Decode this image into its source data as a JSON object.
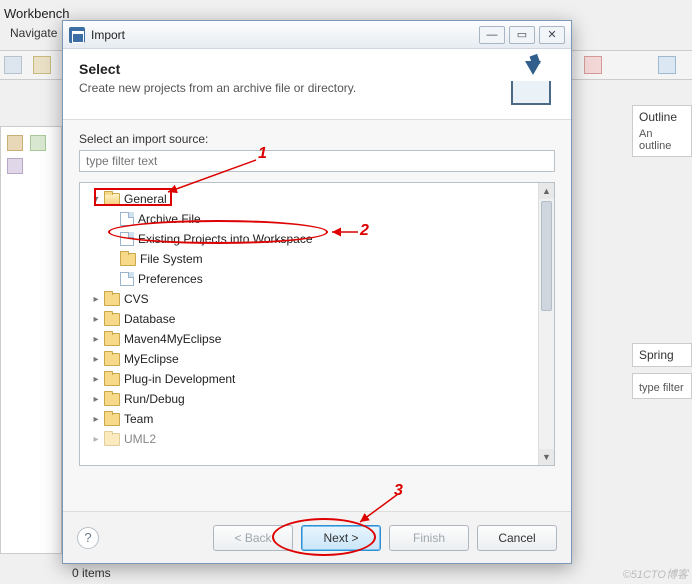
{
  "workbench": {
    "title": "Workbench",
    "menu": "Navigate",
    "status": "0 items",
    "watermark": "©51CTO博客"
  },
  "right_panels": {
    "outline": {
      "title": "Outline",
      "text": "An outline"
    },
    "spring": {
      "title": "Spring",
      "filter": "type filter"
    }
  },
  "dialog": {
    "title": "Import",
    "heading": "Select",
    "subheading": "Create new projects from an archive file or directory.",
    "source_label": "Select an import source:",
    "filter_placeholder": "type filter text",
    "buttons": {
      "back": "< Back",
      "next": "Next >",
      "finish": "Finish",
      "cancel": "Cancel"
    }
  },
  "tree": {
    "general": "General",
    "archive": "Archive File",
    "existing": "Existing Projects into Workspace",
    "filesystem": "File System",
    "preferences": "Preferences",
    "cvs": "CVS",
    "database": "Database",
    "maven": "Maven4MyEclipse",
    "myeclipse": "MyEclipse",
    "plugin": "Plug-in Development",
    "rundebug": "Run/Debug",
    "team": "Team",
    "uml": "UML2"
  },
  "annotations": {
    "n1": "1",
    "n2": "2",
    "n3": "3"
  }
}
